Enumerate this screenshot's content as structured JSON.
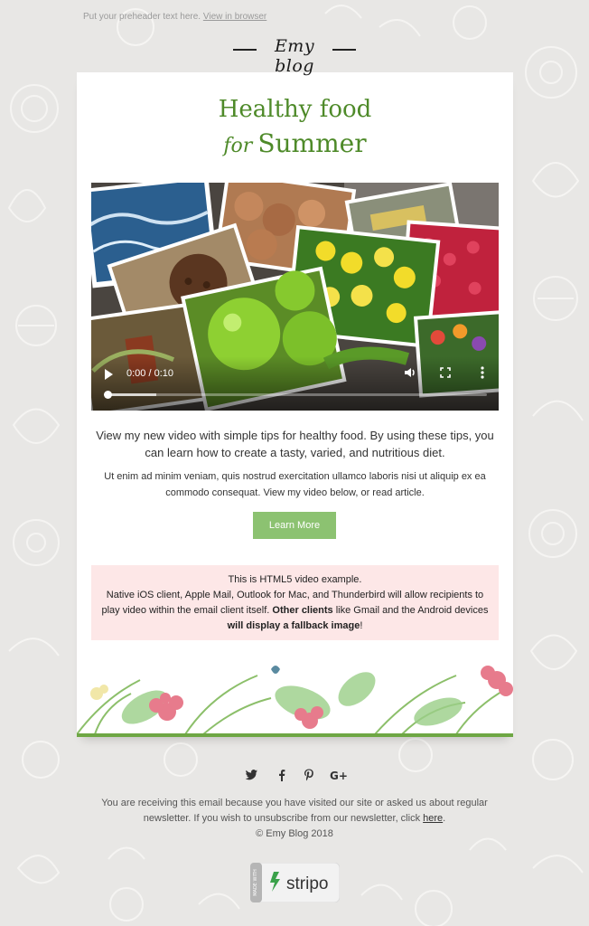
{
  "preheader": {
    "text": "Put your preheader text here.",
    "link": "View in browser"
  },
  "logo": {
    "text": "Emy blog"
  },
  "heading": {
    "line1": "Healthy food",
    "for_word": "for",
    "line2": "Summer"
  },
  "video": {
    "time": "0:00 / 0:10",
    "progress": 0.0,
    "play_icon": "play-icon",
    "volume_icon": "volume-icon",
    "fullscreen_icon": "fullscreen-icon",
    "more_icon": "more-vertical-icon"
  },
  "intro": "View my new video with simple tips for healthy food. By using these tips, you can learn how to create a tasty, varied, and nutritious diet.",
  "body_text": "Ut enim ad minim veniam, quis nostrud exercitation ullamco laboris nisi ut aliquip ex ea commodo consequat. View my video below, or read article.",
  "cta": {
    "label": "Learn More"
  },
  "notice": {
    "title": "This is HTML5 video example.",
    "text_a": "Native iOS client, Apple Mail, Outlook for Mac, and Thunderbird will allow recipients to play video within the email client itself. ",
    "bold_a": "Other clients",
    "text_b": " like Gmail and the Android devices ",
    "bold_b": "will display a fallback image",
    "text_c": "!"
  },
  "social": [
    "twitter-icon",
    "facebook-icon",
    "pinterest-icon",
    "google-plus-icon"
  ],
  "footer": {
    "line1": "You are receiving this email because you have visited our site or asked us about regular newsletter. If you wish to unsubscribe from our newsletter, click ",
    "link": "here",
    "period": ".",
    "copyright": "© Emy Blog 2018"
  },
  "badge": {
    "label": "stripo",
    "side_text": "MADE WITH"
  },
  "colors": {
    "accent_green": "#4e8a29",
    "button": "#8cc271",
    "notice_bg": "#fde7e7",
    "page_bg": "#e8e7e5"
  }
}
